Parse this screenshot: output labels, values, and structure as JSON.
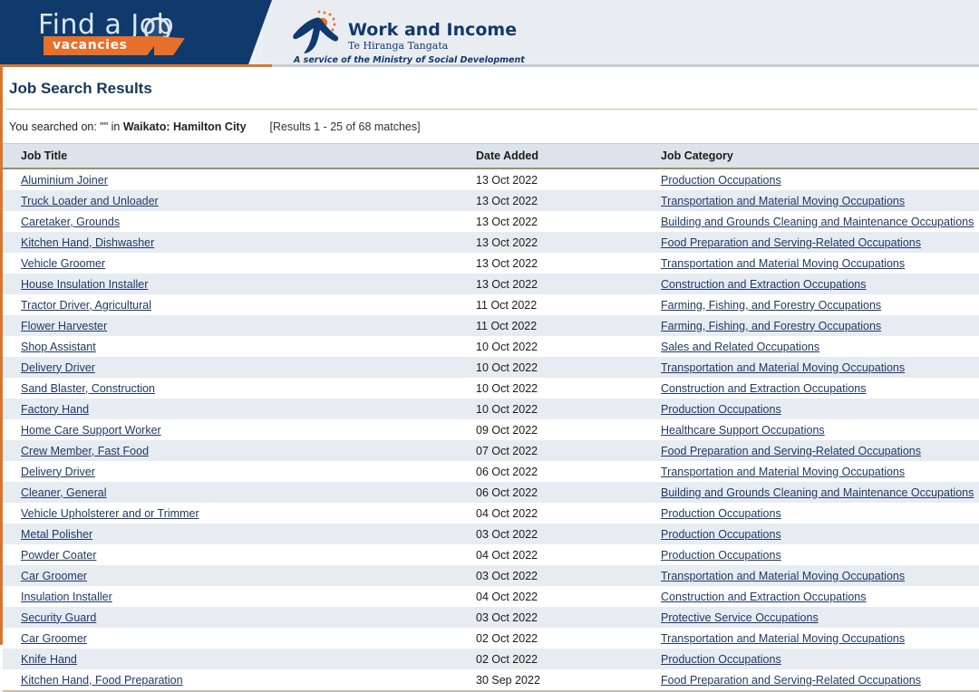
{
  "masthead": {
    "find_a_job": {
      "wordmark": "Find a Job",
      "ribbon_label": "vacancies"
    },
    "work_and_income": {
      "title": "Work and Income",
      "maori_title": "Te Hiranga Tangata",
      "tagline": "A service of the Ministry of Social Development"
    }
  },
  "page": {
    "title": "Job Search Results",
    "search_summary_prefix": "You searched on: \"\" in ",
    "search_location": "Waikato: Hamilton City",
    "results_count": "[Results 1 - 25 of 68 matches]"
  },
  "table": {
    "headers": {
      "job_title": "Job Title",
      "date_added": "Date Added",
      "job_category": "Job Category"
    },
    "rows": [
      {
        "title": "Aluminium Joiner",
        "date": "13 Oct 2022",
        "category": "Production Occupations"
      },
      {
        "title": "Truck Loader and Unloader",
        "date": "13 Oct 2022",
        "category": "Transportation and Material Moving Occupations"
      },
      {
        "title": "Caretaker, Grounds",
        "date": "13 Oct 2022",
        "category": "Building and Grounds Cleaning and Maintenance Occupations"
      },
      {
        "title": "Kitchen Hand, Dishwasher",
        "date": "13 Oct 2022",
        "category": "Food Preparation and Serving-Related Occupations"
      },
      {
        "title": "Vehicle Groomer",
        "date": "13 Oct 2022",
        "category": "Transportation and Material Moving Occupations"
      },
      {
        "title": "House Insulation Installer",
        "date": "13 Oct 2022",
        "category": "Construction and Extraction Occupations"
      },
      {
        "title": "Tractor Driver, Agricultural",
        "date": "11 Oct 2022",
        "category": "Farming, Fishing, and Forestry Occupations"
      },
      {
        "title": "Flower Harvester",
        "date": "11 Oct 2022",
        "category": "Farming, Fishing, and Forestry Occupations"
      },
      {
        "title": "Shop Assistant",
        "date": "10 Oct 2022",
        "category": "Sales and Related Occupations"
      },
      {
        "title": "Delivery Driver",
        "date": "10 Oct 2022",
        "category": "Transportation and Material Moving Occupations"
      },
      {
        "title": "Sand Blaster, Construction",
        "date": "10 Oct 2022",
        "category": "Construction and Extraction Occupations"
      },
      {
        "title": "Factory Hand",
        "date": "10 Oct 2022",
        "category": "Production Occupations"
      },
      {
        "title": "Home Care Support Worker",
        "date": "09 Oct 2022",
        "category": "Healthcare Support Occupations"
      },
      {
        "title": "Crew Member, Fast Food",
        "date": "07 Oct 2022",
        "category": "Food Preparation and Serving-Related Occupations"
      },
      {
        "title": "Delivery Driver",
        "date": "06 Oct 2022",
        "category": "Transportation and Material Moving Occupations"
      },
      {
        "title": "Cleaner, General",
        "date": "06 Oct 2022",
        "category": "Building and Grounds Cleaning and Maintenance Occupations"
      },
      {
        "title": "Vehicle Upholsterer and or Trimmer",
        "date": "04 Oct 2022",
        "category": "Production Occupations"
      },
      {
        "title": "Metal Polisher",
        "date": "03 Oct 2022",
        "category": "Production Occupations"
      },
      {
        "title": "Powder Coater",
        "date": "04 Oct 2022",
        "category": "Production Occupations"
      },
      {
        "title": "Car Groomer",
        "date": "03 Oct 2022",
        "category": "Transportation and Material Moving Occupations"
      },
      {
        "title": "Insulation Installer",
        "date": "04 Oct 2022",
        "category": "Construction and Extraction Occupations"
      },
      {
        "title": "Security Guard",
        "date": "03 Oct 2022",
        "category": "Protective Service Occupations"
      },
      {
        "title": "Car Groomer",
        "date": "02 Oct 2022",
        "category": "Transportation and Material Moving Occupations"
      },
      {
        "title": "Knife Hand",
        "date": "02 Oct 2022",
        "category": "Production Occupations"
      },
      {
        "title": "Kitchen Hand, Food Preparation",
        "date": "30 Sep 2022",
        "category": "Food Preparation and Serving-Related Occupations"
      }
    ]
  },
  "colors": {
    "masthead_blue": "#103a6b",
    "accent_orange": "#d8772a",
    "link_navy": "#1f3864",
    "title_navy": "#17365d",
    "row_stripe": "#e7ecf2",
    "table_header_bg": "#dde3ea"
  }
}
